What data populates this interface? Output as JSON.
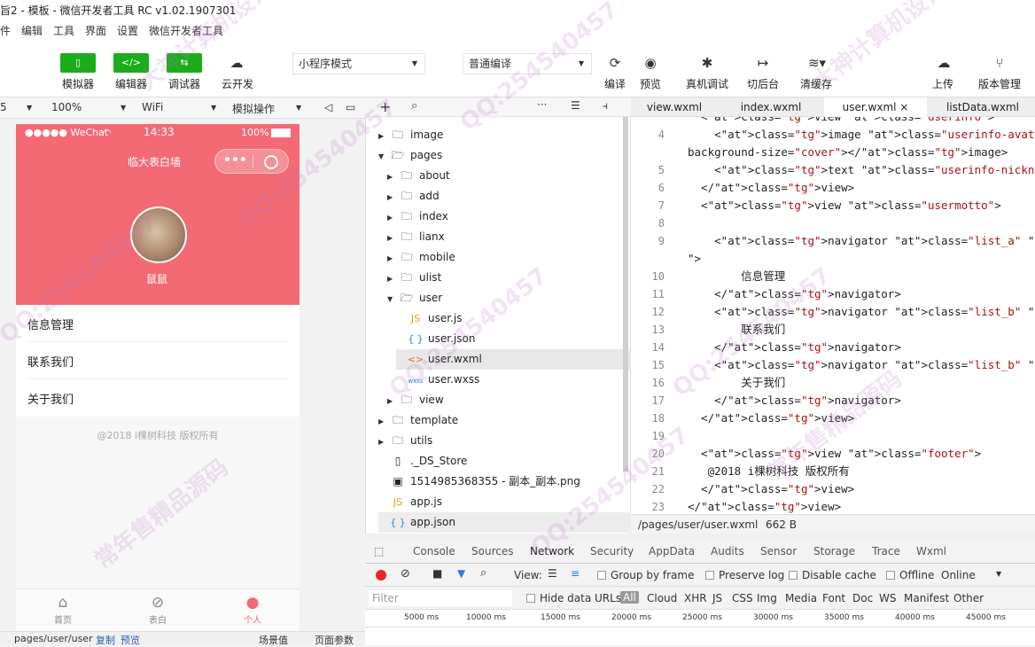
{
  "window": {
    "title": "旨2 - 模板 - 微信开发者工具 RC v1.02.1907301"
  },
  "menu": [
    "件",
    "编辑",
    "工具",
    "界面",
    "设置",
    "微信开发者工具"
  ],
  "toolbar": {
    "simulator": "模拟器",
    "editor": "编辑器",
    "debugger": "调试器",
    "cloud": "云开发",
    "mode": "小程序模式",
    "compile_mode": "普通编译",
    "compile": "编译",
    "preview": "预览",
    "remote_debug": "真机调试",
    "background": "切后台",
    "clear_cache": "清缓存",
    "upload": "上传",
    "version": "版本管理"
  },
  "sim_bar": {
    "device": "5",
    "zoom": "100%",
    "network": "WiFi",
    "ops": "模拟操作"
  },
  "phone": {
    "carrier": "●●●●● WeChat",
    "time": "14:33",
    "battery": "100%",
    "nav_title": "临大表白墙",
    "username": "鼠鼠",
    "menu": [
      "信息管理",
      "联系我们",
      "关于我们"
    ],
    "footer": "@2018 i棵树科技 版权所有",
    "tabs": [
      "首页",
      "表白",
      "个人"
    ]
  },
  "sim_bottom": {
    "path": "pages/user/user",
    "copy": "复制",
    "preview": "预览",
    "scene": "场景值",
    "params": "页面参数"
  },
  "explorer": {
    "items": [
      {
        "name": "image",
        "type": "folder",
        "open": false
      },
      {
        "name": "pages",
        "type": "folder",
        "open": true
      },
      {
        "name": "about",
        "type": "folder",
        "open": false
      },
      {
        "name": "add",
        "type": "folder",
        "open": false
      },
      {
        "name": "index",
        "type": "folder",
        "open": false
      },
      {
        "name": "lianx",
        "type": "folder",
        "open": false
      },
      {
        "name": "mobile",
        "type": "folder",
        "open": false
      },
      {
        "name": "ulist",
        "type": "folder",
        "open": false
      },
      {
        "name": "user",
        "type": "folder",
        "open": true
      },
      {
        "name": "user.js",
        "type": "js"
      },
      {
        "name": "user.json",
        "type": "json"
      },
      {
        "name": "user.wxml",
        "type": "wxml"
      },
      {
        "name": "user.wxss",
        "type": "wxss"
      },
      {
        "name": "view",
        "type": "folder",
        "open": false
      },
      {
        "name": "template",
        "type": "folder",
        "open": false
      },
      {
        "name": "utils",
        "type": "folder",
        "open": false
      },
      {
        "name": "._DS_Store",
        "type": "file"
      },
      {
        "name": "1514985368355 - 副本_副本.png",
        "type": "image"
      },
      {
        "name": "app.js",
        "type": "js"
      },
      {
        "name": "app.json",
        "type": "json"
      }
    ]
  },
  "editor": {
    "tabs": [
      "view.wxml",
      "index.wxml",
      "user.wxml",
      "listData.wxml"
    ],
    "close": "×",
    "line_numbers": [
      "4",
      "",
      "5",
      "6",
      "7",
      "8",
      "9",
      "",
      "10",
      "11",
      "12",
      "13",
      "14",
      "15",
      "16",
      "17",
      "18",
      "19",
      "20",
      "21",
      "22",
      "23"
    ],
    "top_partial": "  <view class=\"userinfo\">",
    "lines": [
      "    <image class=\"userinfo-avatar\" src=\"{{userInfo.",
      "background-size=\"cover\"></image>",
      "    <text class=\"userinfo-nickname\">{{userInfo.nick",
      "  </view>",
      "  <view class=\"usermotto\">",
      "",
      "    <navigator class=\"list_a\" url=\"../ulist/ulist?o",
      "\">",
      "        信息管理",
      "    </navigator>",
      "    <navigator class=\"list_b\" url=\"../lianx/lianx\">",
      "        联系我们",
      "    </navigator>",
      "    <navigator class=\"list_b\" url=\"../about/about\">",
      "        关于我们",
      "    </navigator>",
      "  </view>",
      "",
      "  <view class=\"footer\">",
      "   @2018 i棵树科技 版权所有",
      "  </view>",
      "</view>"
    ],
    "status_path": "/pages/user/user.wxml",
    "status_size": "662 B"
  },
  "devtools": {
    "tabs": [
      "Console",
      "Sources",
      "Network",
      "Security",
      "AppData",
      "Audits",
      "Sensor",
      "Storage",
      "Trace",
      "Wxml"
    ],
    "active": "Network",
    "view": "View:",
    "group": "Group by frame",
    "preserve": "Preserve log",
    "disable_cache": "Disable cache",
    "offline": "Offline",
    "online": "Online",
    "filter": "Filter",
    "hide_urls": "Hide data URLs",
    "all": "All",
    "types": [
      "Cloud",
      "XHR",
      "JS",
      "CSS",
      "Img",
      "Media",
      "Font",
      "Doc",
      "WS",
      "Manifest",
      "Other"
    ],
    "ticks": [
      "5000 ms",
      "10000 ms",
      "15000 ms",
      "20000 ms",
      "25000 ms",
      "30000 ms",
      "35000 ms",
      "40000 ms",
      "45000 ms"
    ]
  },
  "watermarks": [
    "QQ:254540457",
    "常年售精品源码",
    "大神计算机设计"
  ],
  "colors": {
    "accent": "#1aad19",
    "header": "#f36a74"
  }
}
